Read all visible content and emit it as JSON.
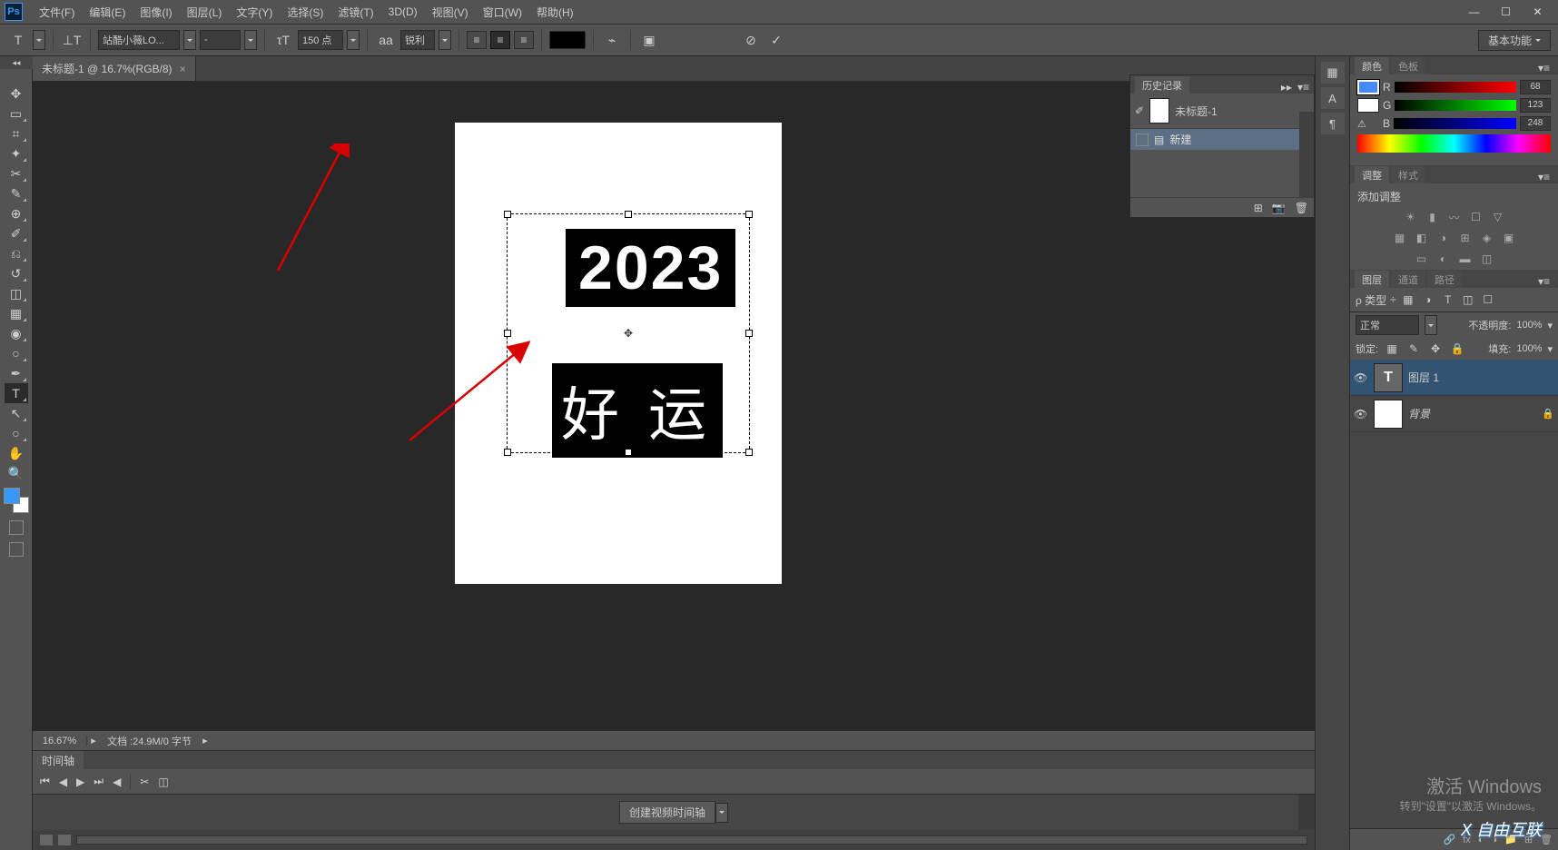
{
  "app": {
    "ps": "Ps"
  },
  "menu": [
    "文件(F)",
    "编辑(E)",
    "图像(I)",
    "图层(L)",
    "文字(Y)",
    "选择(S)",
    "滤镜(T)",
    "3D(D)",
    "视图(V)",
    "窗口(W)",
    "帮助(H)"
  ],
  "optbar": {
    "orientation_icon": "T",
    "font": "站酷小薇LO...",
    "style": "-",
    "size": "150 点",
    "aa": "锐利",
    "aa_label": "aa",
    "workspace": "基本功能"
  },
  "tab": {
    "title": "未标题-1 @ 16.7%(RGB/8)",
    "close": "×"
  },
  "canvas": {
    "text1": "2023",
    "text2": "好 运",
    "center": "✥"
  },
  "status": {
    "zoom": "16.67%",
    "doc": "文档 :24.9M/0 字节"
  },
  "timeline": {
    "tab": "时间轴",
    "create": "创建视频时间轴"
  },
  "history": {
    "tab": "历史记录",
    "doc": "未标题-1",
    "item": "新建"
  },
  "color": {
    "tab1": "颜色",
    "tab2": "色板",
    "r_label": "R",
    "g_label": "G",
    "b_label": "B",
    "r": "68",
    "g": "123",
    "b": "248"
  },
  "adjust": {
    "tab1": "调整",
    "tab2": "样式",
    "label": "添加调整"
  },
  "layers": {
    "tab1": "图层",
    "tab2": "通道",
    "tab3": "路径",
    "kind": "ρ 类型",
    "blend": "正常",
    "opacity_label": "不透明度:",
    "opacity": "100%",
    "lock_label": "锁定:",
    "fill_label": "填充:",
    "fill": "100%",
    "layer1": "图层 1",
    "bg": "背景",
    "T": "T"
  },
  "watermark": {
    "title": "激活 Windows",
    "sub": "转到\"设置\"以激活 Windows。",
    "logo": "X 自由互联"
  },
  "icons": {
    "move": "✥",
    "marq": "▭",
    "lasso": "⌗",
    "wand": "✦",
    "crop": "✂",
    "eyedrop": "✎",
    "heal": "⊕",
    "brush": "✐",
    "stamp": "⎌",
    "history": "↺",
    "eraser": "◫",
    "gradient": "▦",
    "blur": "◉",
    "dodge": "○",
    "pen": "✒",
    "type": "T",
    "path": "↖",
    "ellipse": "○",
    "hand": "✋",
    "zoom": "🔍",
    "warp": "⌁",
    "commit": "✓",
    "cancel": "⊘",
    "panel": "▣",
    "camera": "📷",
    "trash": "🗑",
    "new": "⊞",
    "eye": "👁",
    "lock": "🔒",
    "go_start": "⏮",
    "prev": "◀",
    "play": "▶",
    "next": "⏭",
    "go_end": "⏭",
    "scissors": "✂",
    "transition": "◫",
    "fx": "fx",
    "mask": "◐",
    "folder": "📁",
    "link": "🔗",
    "adj": "◑"
  }
}
